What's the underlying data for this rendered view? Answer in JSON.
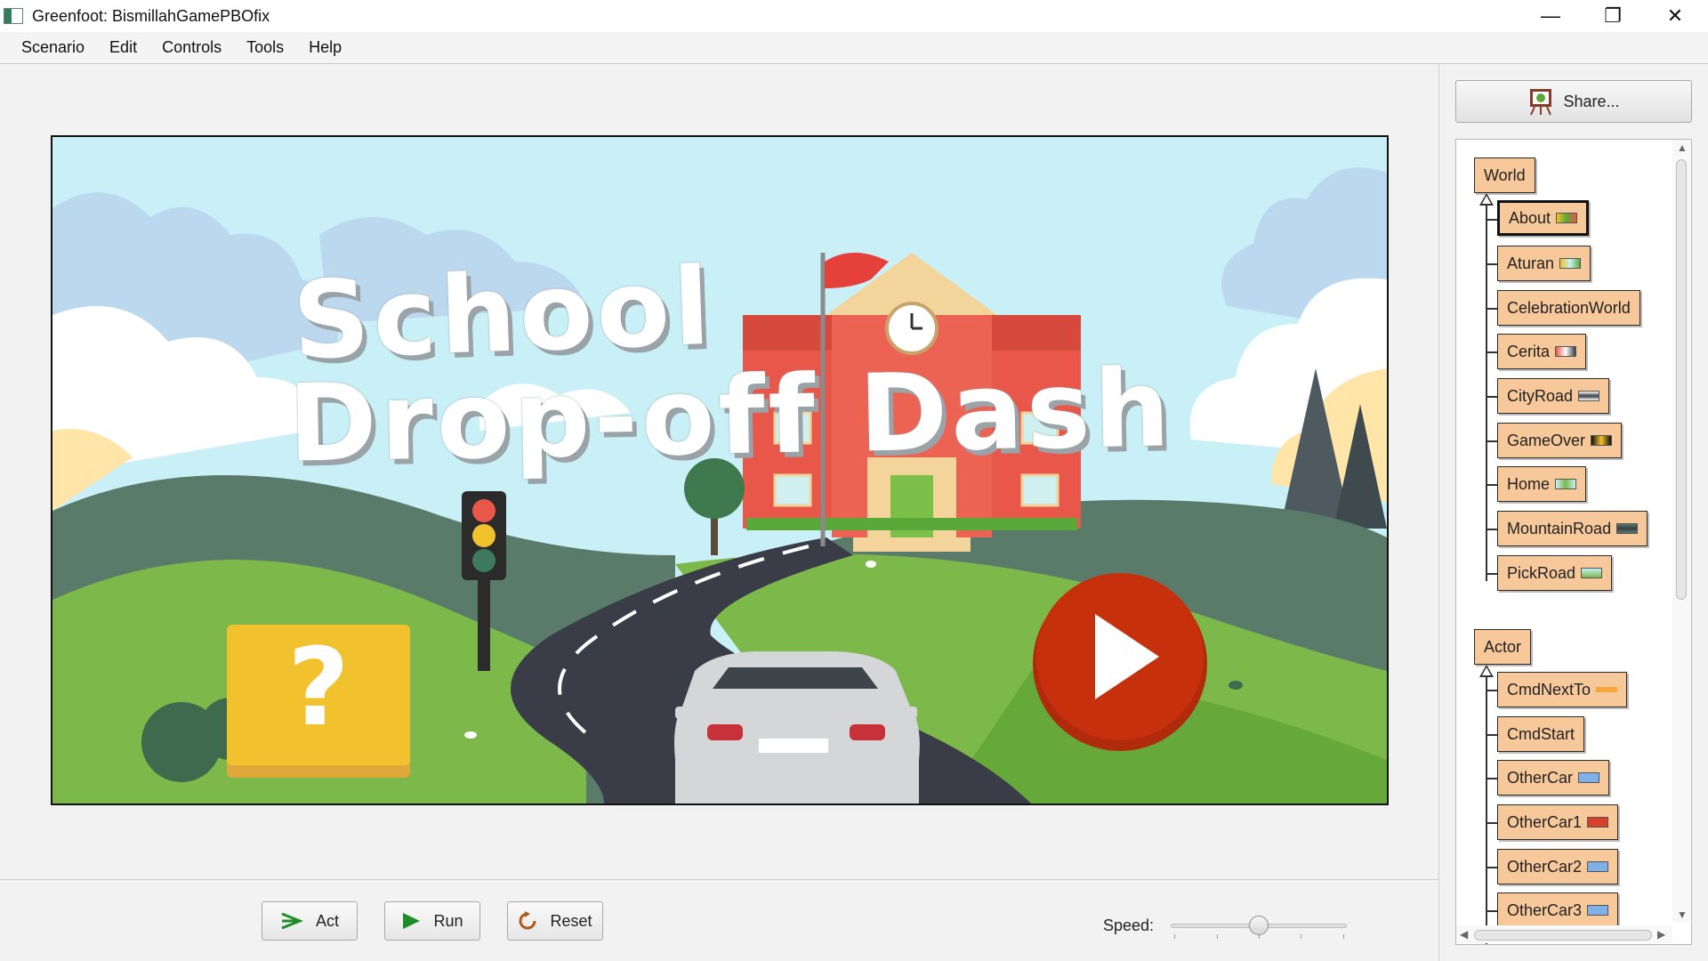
{
  "window": {
    "title": "Greenfoot: BismillahGamePBOfix",
    "minimize_icon": "—",
    "restore_icon": "❐",
    "close_icon": "✕"
  },
  "menu": [
    "Scenario",
    "Edit",
    "Controls",
    "Tools",
    "Help"
  ],
  "world": {
    "title_line1": "School",
    "title_line2": "Drop-off Dash",
    "help_symbol": "?"
  },
  "controls": {
    "act_label": "Act",
    "run_label": "Run",
    "reset_label": "Reset",
    "speed_label": "Speed:",
    "speed_value": 0.5
  },
  "share": {
    "label": "Share..."
  },
  "class_tree": {
    "world_root": "World",
    "world_subclasses": [
      "About",
      "Aturan",
      "CelebrationWorld",
      "Cerita",
      "CityRoad",
      "GameOver",
      "Home",
      "MountainRoad",
      "PickRoad"
    ],
    "selected": "About",
    "actor_root": "Actor",
    "actor_subclasses": [
      "CmdNextTo",
      "CmdStart",
      "OtherCar",
      "OtherCar1",
      "OtherCar2",
      "OtherCar3"
    ]
  },
  "colors": {
    "class_fill": "#f6c89a",
    "sky": "#c8f0f6",
    "play_button": "#c7300d",
    "help_box": "#f2c12e"
  }
}
